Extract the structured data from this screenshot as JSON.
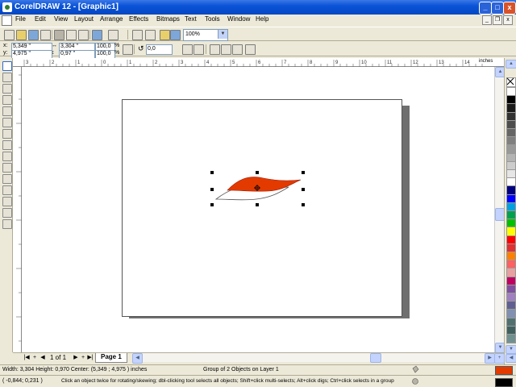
{
  "window": {
    "title": "CorelDRAW 12 - [Graphic1]",
    "controls": {
      "minimize": "_",
      "maximize": "□",
      "close": "x"
    }
  },
  "menu": {
    "items": [
      "File",
      "Edit",
      "View",
      "Layout",
      "Arrange",
      "Effects",
      "Bitmaps",
      "Text",
      "Tools",
      "Window",
      "Help"
    ],
    "doc_controls": {
      "minimize": "_",
      "restore": "❐",
      "close": "x"
    }
  },
  "standard_toolbar": {
    "zoom_level": "100%"
  },
  "property_bar": {
    "x_label": "x:",
    "y_label": "y:",
    "x_value": "5,349 \"",
    "y_value": "4,975 \"",
    "width_value": "3,304 \"",
    "height_value": "0,97 \"",
    "scale_x": "100,0",
    "scale_y": "100,0",
    "percent_x": "%",
    "percent_y": "%",
    "rotation_value": "0,0"
  },
  "ruler": {
    "unit_label": "inches",
    "h_ticks": [
      "3",
      "2",
      "1",
      "0",
      "1",
      "2",
      "3",
      "4",
      "5",
      "6",
      "7",
      "8",
      "9",
      "10",
      "11",
      "12",
      "13",
      "14"
    ]
  },
  "page_nav": {
    "first": "|◀",
    "prev": "◀",
    "counter": "1 of 1",
    "next": "▶",
    "last": "▶|",
    "add": "+",
    "add2": "+",
    "tab_label": "Page 1"
  },
  "status": {
    "dimensions": "Width: 3,304  Height: 0,970  Center: (5,349 ; 4,975 )  inches",
    "selection": "Group of 2 Objects on Layer 1",
    "cursor_pos": "( -0,844; 0,231 )",
    "hint": "Click an object twice for rotating/skewing; dbl-clicking tool selects all objects; Shift+click multi-selects; Alt+click digs; Ctrl+click selects in a group"
  },
  "colors": {
    "accent_fill": "#e33a00",
    "selection_handle": "#000000",
    "palette": [
      "#ffffff",
      "#000000",
      "#1a1a1a",
      "#333333",
      "#4d4d4d",
      "#666666",
      "#808080",
      "#999999",
      "#b3b3b3",
      "#cccccc",
      "#e6e6e6",
      "#ffffff",
      "#000080",
      "#0000ff",
      "#00a0e0",
      "#00a050",
      "#00c000",
      "#ffff00",
      "#ff0000",
      "#e03030",
      "#ff8000",
      "#ff6060",
      "#e8a0a0",
      "#c00060",
      "#8050a0",
      "#a080c0",
      "#606090",
      "#8090b0",
      "#507070",
      "#406060",
      "#709090"
    ]
  }
}
